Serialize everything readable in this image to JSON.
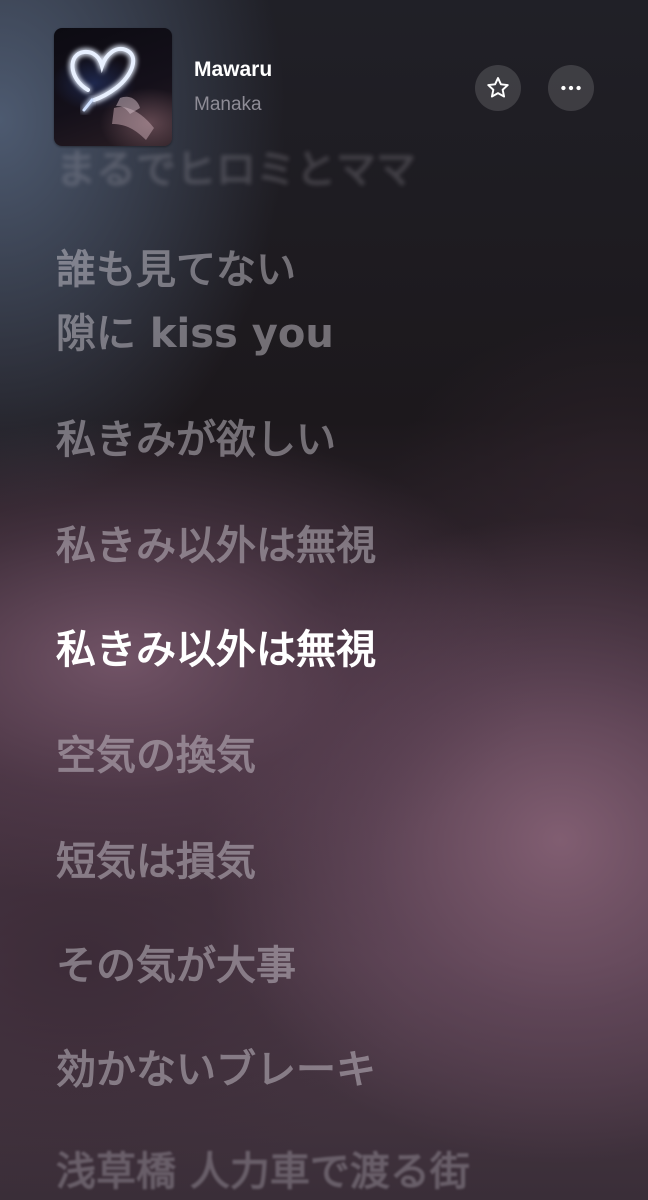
{
  "now_playing": {
    "title": "Mawaru",
    "artist": "Manaka",
    "artwork": "neon-heart-artwork",
    "favorite_icon": "star-outline-icon",
    "more_icon": "ellipsis-icon"
  },
  "lyrics": {
    "previous_line": "まるでヒロミとママ",
    "lines": [
      {
        "first": "誰も見てない",
        "second": "隙に kiss you"
      },
      {
        "text": "私きみが欲しい"
      },
      {
        "text": "私きみ以外は無視"
      },
      {
        "text": "私きみ以外は無視"
      },
      {
        "text": "空気の換気"
      },
      {
        "text": "短気は損気"
      },
      {
        "text": "その気が大事"
      },
      {
        "text": "効かないブレーキ"
      },
      {
        "text": "浅草橋 人力車で渡る街"
      }
    ],
    "active_index": 3
  },
  "colors": {
    "title": "#ffffff",
    "artist": "#8e8c96",
    "active_line": "#ffffff"
  }
}
